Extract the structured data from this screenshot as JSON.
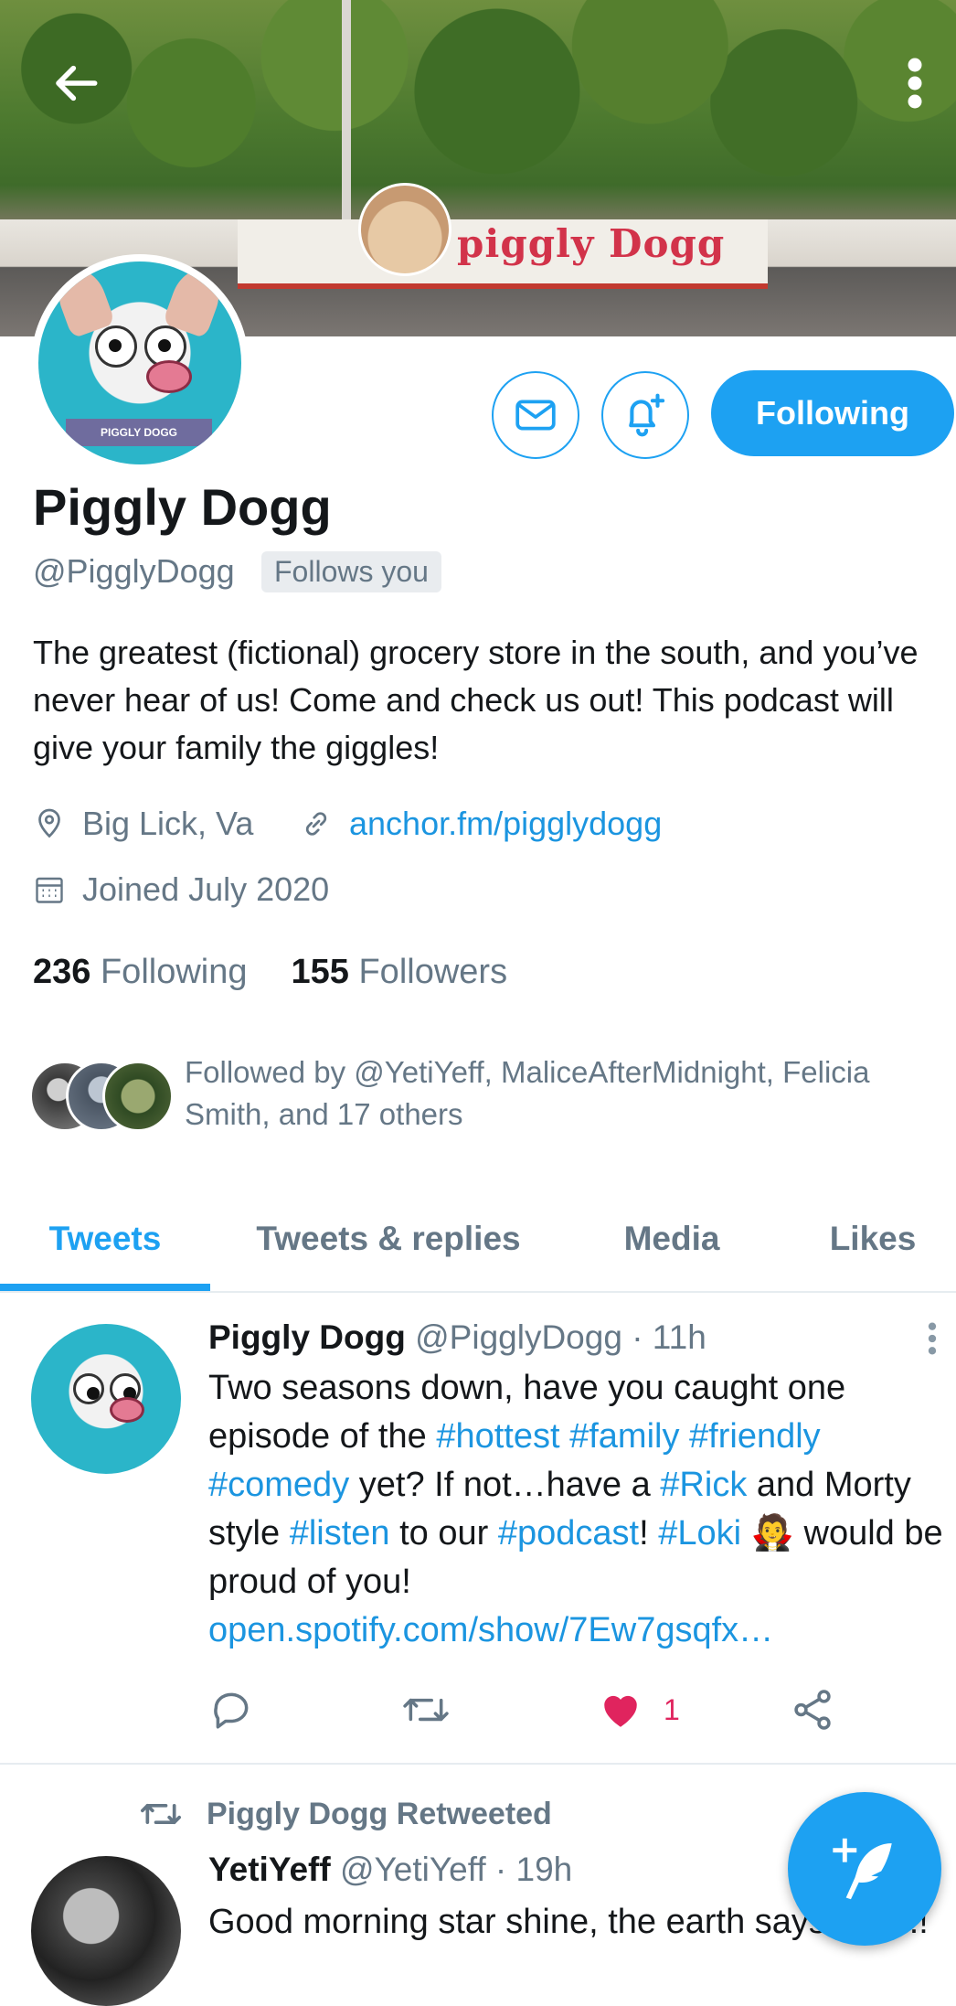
{
  "banner": {
    "sign_text": "piggly Dogg"
  },
  "profile": {
    "avatar_text": "PIGGLY DOGG",
    "name": "Piggly Dogg",
    "handle": "@PigglyDogg",
    "follows_badge": "Follows you",
    "bio": "The greatest (fictional) grocery store in the south, and you’ve never hear of us! Come and check us out! This podcast will give your family the giggles!",
    "location": "Big Lick, Va",
    "website": "anchor.fm/pigglydogg",
    "joined": "Joined July 2020",
    "following_count": "236",
    "following_label": "Following",
    "followers_count": "155",
    "followers_label": "Followers",
    "followed_by": "Followed by @YetiYeff, MaliceAfterMidnight, Felicia Smith, and 17 others"
  },
  "actions": {
    "following_button": "Following"
  },
  "tabs": [
    {
      "label": "Tweets",
      "active": true
    },
    {
      "label": "Tweets & replies",
      "active": false
    },
    {
      "label": "Media",
      "active": false
    },
    {
      "label": "Likes",
      "active": false
    }
  ],
  "tweet1": {
    "name": "Piggly Dogg",
    "handle": "@PigglyDogg",
    "time": "· 11h",
    "body": {
      "t1": "Two seasons down, have you caught one episode of the ",
      "h1": "#hottest",
      "h2": "#family",
      "h3": "#friendly",
      "h4": "#comedy",
      "t2": " yet? If not…have a ",
      "h5": "#Rick",
      "t3": " and Morty style ",
      "h6": "#listen",
      "t4": " to our ",
      "h7": "#podcast",
      "t5": "! ",
      "h8": "#Loki",
      "emoji": "🧛",
      "t6": " would be proud of you! ",
      "link": "open.spotify.com/show/7Ew7gsqfx…"
    },
    "like_count": "1"
  },
  "retweet_label": "Piggly Dogg Retweeted",
  "tweet2": {
    "name": "YetiYeff",
    "handle": "@YetiYeff",
    "time": "· 19h",
    "body": "Good morning star shine, the earth says hello!!"
  },
  "colors": {
    "accent": "#1da1f2",
    "like": "#e0245e",
    "muted": "#657786"
  }
}
